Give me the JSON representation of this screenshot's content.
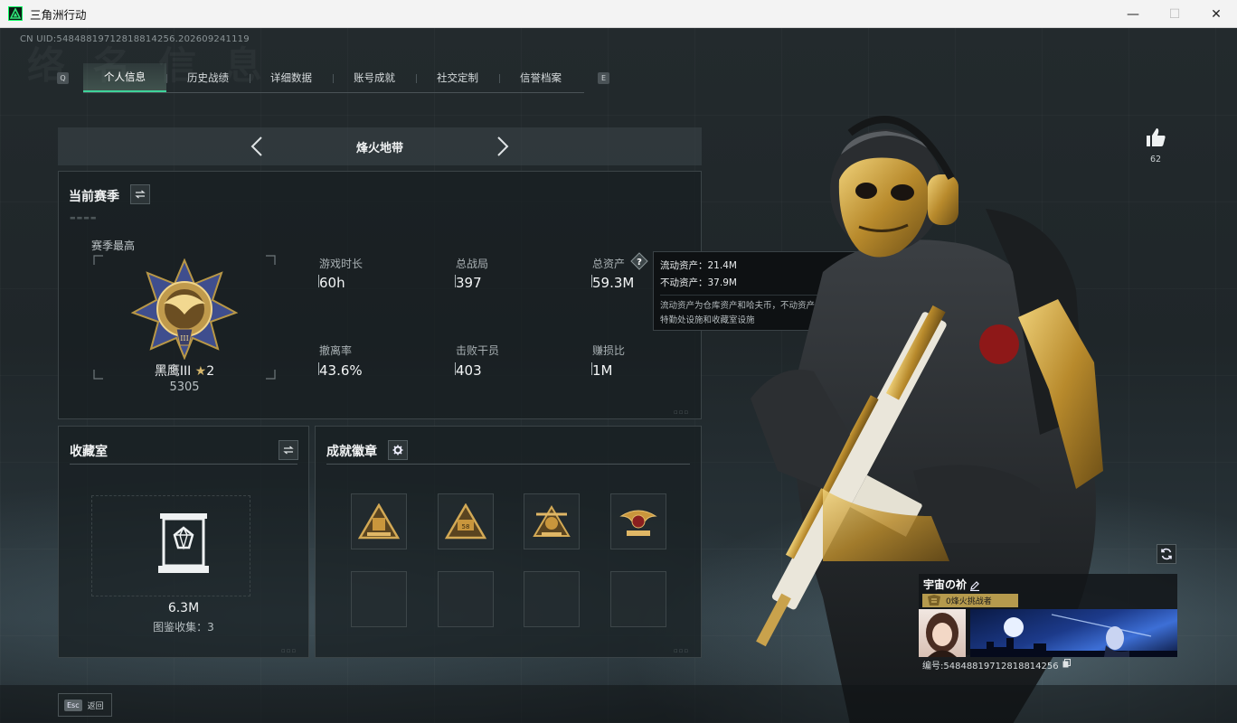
{
  "window": {
    "title": "三角洲行动",
    "minimize": "—",
    "maximize": "☐",
    "close": "✕"
  },
  "header": {
    "uid": "CN UID:5484881971281881​4256.202609241119",
    "ghost_title": "络 名 信 息",
    "key_left": "Q",
    "key_right": "E"
  },
  "tabs": [
    {
      "label": "个人信息",
      "active": true
    },
    {
      "label": "历史战绩",
      "active": false
    },
    {
      "label": "详细数据",
      "active": false
    },
    {
      "label": "账号成就",
      "active": false
    },
    {
      "label": "社交定制",
      "active": false
    },
    {
      "label": "信誉档案",
      "active": false
    }
  ],
  "mode": {
    "label": "烽火地带"
  },
  "season": {
    "title": "当前赛季",
    "best_label": "赛季最高",
    "rank_name": "黑鹰III",
    "rank_stars": "2",
    "rank_points": "5305",
    "stats": [
      {
        "label": "游戏时长",
        "value": "60h"
      },
      {
        "label": "总战局",
        "value": "397"
      },
      {
        "label": "总资产",
        "value": "59.3M"
      },
      {
        "label": "撤离率",
        "value": "43.6%"
      },
      {
        "label": "击败干员",
        "value": "403"
      },
      {
        "label": "赚损比",
        "value": "1M"
      }
    ]
  },
  "tooltip": {
    "liquid": "流动资产：21.4M",
    "fixed": "不动资产：37.9M",
    "note_1": "流动资产为仓库资产和哈夫币，不动资产为",
    "note_2": "特勤处设施和收藏室设施"
  },
  "collection": {
    "title": "收藏室",
    "value": "6.3M",
    "catalog": "图鉴收集：3"
  },
  "achievements": {
    "title": "成就徽章",
    "badges": [
      "badge-1",
      "badge-58",
      "badge-3",
      "badge-4"
    ]
  },
  "profile": {
    "likes": "62",
    "name": "宇宙の衸",
    "badge": "0烽火挑战者",
    "id_label": "编号:5484881971281881​4256"
  },
  "footer": {
    "esc_key": "Esc",
    "back": "返回"
  },
  "colors": {
    "accent": "#3fd39a",
    "gold": "#c9a24c",
    "panel": "#181e21"
  }
}
